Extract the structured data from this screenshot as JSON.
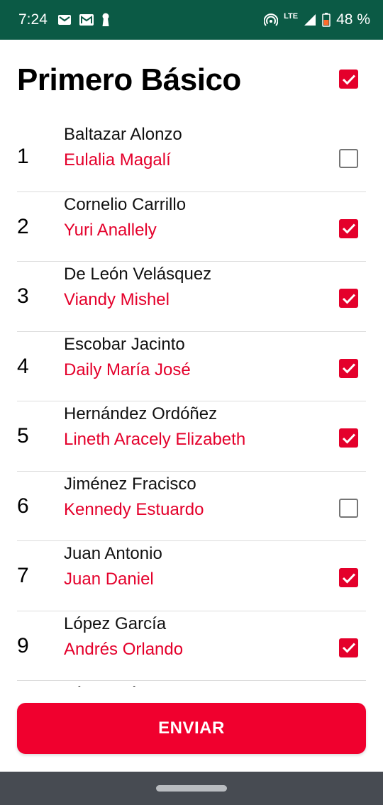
{
  "status_bar": {
    "time": "7:24",
    "network": "LTE",
    "battery": "48 %"
  },
  "header": {
    "title": "Primero Básico",
    "select_all_checked": true
  },
  "students": [
    {
      "number": "1",
      "surname": "Baltazar Alonzo",
      "given": "Eulalia Magalí",
      "checked": false
    },
    {
      "number": "2",
      "surname": "Cornelio Carrillo",
      "given": "Yuri Anallely",
      "checked": true
    },
    {
      "number": "3",
      "surname": "De León Velásquez",
      "given": "Viandy Mishel",
      "checked": true
    },
    {
      "number": "4",
      "surname": "Escobar Jacinto",
      "given": "Daily María José",
      "checked": true
    },
    {
      "number": "5",
      "surname": "Hernández Ordóñez",
      "given": "Lineth Aracely Elizabeth",
      "checked": true
    },
    {
      "number": "6",
      "surname": "Jiménez Fracisco",
      "given": "Kennedy Estuardo",
      "checked": false
    },
    {
      "number": "7",
      "surname": "Juan Antonio",
      "given": "Juan Daniel",
      "checked": true
    },
    {
      "number": "9",
      "surname": "López García",
      "given": "Andrés Orlando",
      "checked": true
    },
    {
      "number": "",
      "surname": "López Gómez",
      "given": "",
      "checked": false
    }
  ],
  "send_button_label": "ENVIAR",
  "colors": {
    "status_bar": "#0b5a45",
    "accent": "#e4002b",
    "button": "#f0002e",
    "nav_bar": "#474b52"
  }
}
